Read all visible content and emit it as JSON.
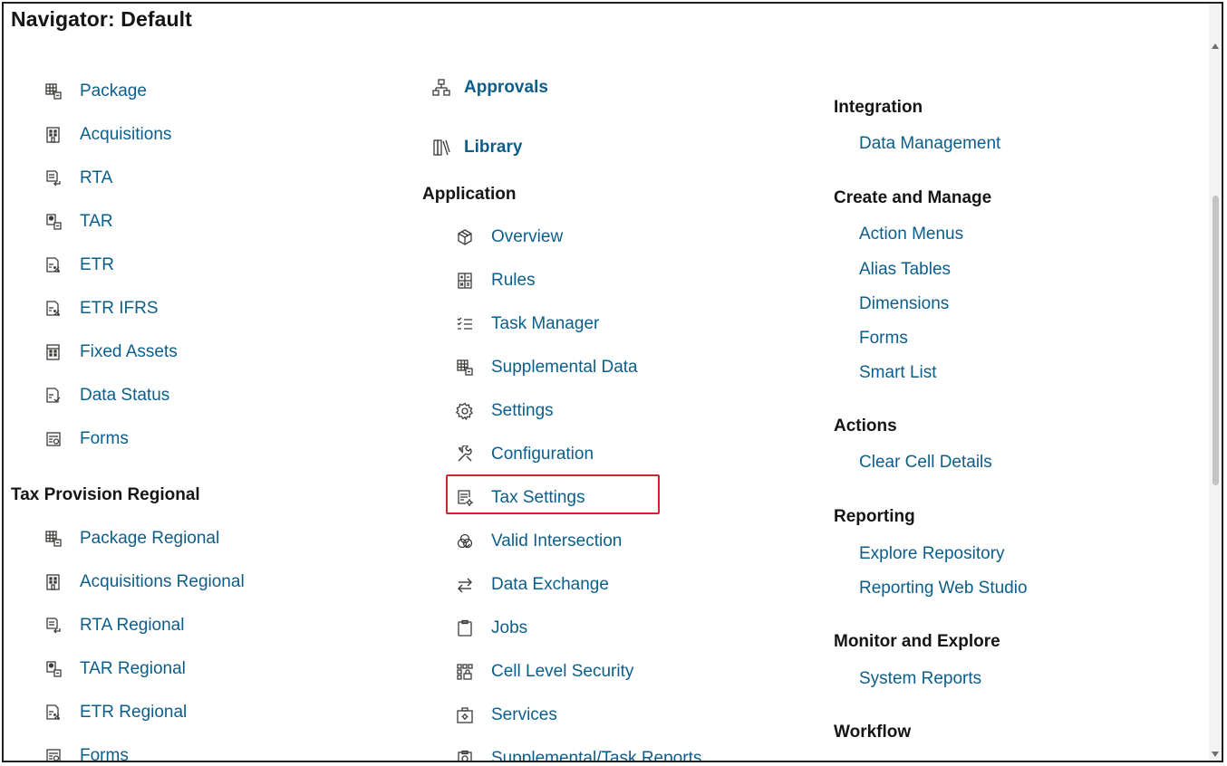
{
  "title": "Navigator: Default",
  "col1": {
    "items": [
      {
        "label": "Package",
        "icon": "grid-table-icon"
      },
      {
        "label": "Acquisitions",
        "icon": "building-icon"
      },
      {
        "label": "RTA",
        "icon": "document-return-icon"
      },
      {
        "label": "TAR",
        "icon": "document-calc-icon"
      },
      {
        "label": "ETR",
        "icon": "document-percent-icon"
      },
      {
        "label": "ETR IFRS",
        "icon": "document-percent-icon"
      },
      {
        "label": "Fixed Assets",
        "icon": "building-icon"
      },
      {
        "label": "Data Status",
        "icon": "document-check-icon"
      },
      {
        "label": "Forms",
        "icon": "form-icon"
      }
    ],
    "section2_heading": "Tax Provision Regional",
    "items2": [
      {
        "label": "Package Regional",
        "icon": "grid-table-icon"
      },
      {
        "label": "Acquisitions Regional",
        "icon": "building-icon"
      },
      {
        "label": "RTA Regional",
        "icon": "document-return-icon"
      },
      {
        "label": "TAR Regional",
        "icon": "document-calc-icon"
      },
      {
        "label": "ETR Regional",
        "icon": "document-percent-icon"
      },
      {
        "label": "Forms",
        "icon": "form-icon"
      }
    ]
  },
  "col2": {
    "approvals": "Approvals",
    "library": "Library",
    "application_heading": "Application",
    "items": [
      {
        "label": "Overview",
        "icon": "cube-icon"
      },
      {
        "label": "Rules",
        "icon": "calculator-icon"
      },
      {
        "label": "Task Manager",
        "icon": "checklist-icon"
      },
      {
        "label": "Supplemental Data",
        "icon": "grid-table-icon"
      },
      {
        "label": "Settings",
        "icon": "gear-icon"
      },
      {
        "label": "Configuration",
        "icon": "tools-icon"
      },
      {
        "label": "Tax Settings",
        "icon": "settings-doc-icon"
      },
      {
        "label": "Valid Intersection",
        "icon": "intersection-icon"
      },
      {
        "label": "Data Exchange",
        "icon": "exchange-icon"
      },
      {
        "label": "Jobs",
        "icon": "clipboard-icon"
      },
      {
        "label": "Cell Level Security",
        "icon": "security-grid-icon"
      },
      {
        "label": "Services",
        "icon": "toolbox-icon"
      },
      {
        "label": "Supplemental/Task Reports",
        "icon": "report-icon"
      }
    ]
  },
  "col3": {
    "integration_heading": "Integration",
    "data_management": "Data Management",
    "create_heading": "Create and Manage",
    "create_items": [
      "Action Menus",
      "Alias Tables",
      "Dimensions",
      "Forms",
      "Smart List"
    ],
    "actions_heading": "Actions",
    "clear_cell": "Clear Cell Details",
    "reporting_heading": "Reporting",
    "reporting_items": [
      "Explore Repository",
      "Reporting Web Studio"
    ],
    "monitor_heading": "Monitor and Explore",
    "system_reports": "System Reports",
    "workflow_heading": "Workflow"
  },
  "colors": {
    "link": "#0b5e8c",
    "heading": "#161513",
    "highlight": "#d6222b"
  }
}
